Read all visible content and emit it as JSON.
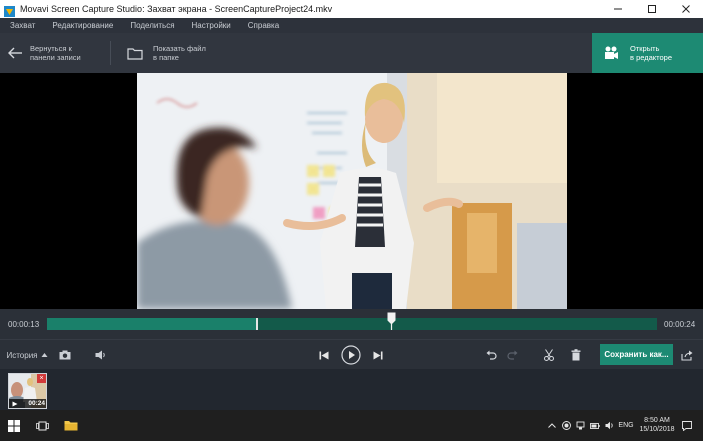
{
  "window": {
    "title": "Movavi Screen Capture Studio: Захват экрана - ScreenCaptureProject24.mkv"
  },
  "menu": {
    "items": [
      "Захват",
      "Редактирование",
      "Поделиться",
      "Настройки",
      "Справка"
    ]
  },
  "toolbar": {
    "back_label": "Вернуться к\nпанели записи",
    "folder_label": "Показать файл\nв папке",
    "open_label": "Открыть\nв редакторе"
  },
  "timeline": {
    "current_time": "00:00:13",
    "total_time": "00:00:24",
    "played_fraction": 0.345,
    "playhead_fraction": 0.565
  },
  "controls": {
    "history_label": "История",
    "save_label": "Сохранить как..."
  },
  "history": {
    "thumbnail_duration": "00:24"
  },
  "taskbar": {
    "language": "ENG",
    "time": "8:50 AM",
    "date": "15/10/2018"
  },
  "colors": {
    "accent": "#1d8a73",
    "track": "#135a4a",
    "track_played": "#1a806a"
  },
  "icons": [
    "back-arrow-icon",
    "folder-icon",
    "open-editor-icon",
    "camera-icon",
    "volume-icon",
    "skip-back-icon",
    "play-icon",
    "skip-forward-icon",
    "undo-icon",
    "redo-icon",
    "scissors-icon",
    "trash-icon",
    "share-icon"
  ]
}
